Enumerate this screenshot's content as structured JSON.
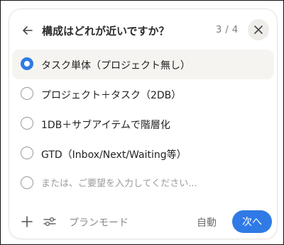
{
  "header": {
    "title": "構成はどれが近いですか？",
    "counter": "3 / 4"
  },
  "options": [
    {
      "label": "タスク単体（プロジェクト無し）",
      "selected": true
    },
    {
      "label": "プロジェクト＋タスク（2DB）",
      "selected": false
    },
    {
      "label": "1DB＋サブアイテムで階層化",
      "selected": false
    },
    {
      "label": "GTD（Inbox/Next/Waiting等）",
      "selected": false
    }
  ],
  "custom": {
    "placeholder": "または、ご要望を入力してください..."
  },
  "footer": {
    "plan_mode_label": "プランモード",
    "auto_label": "自動",
    "next_label": "次へ"
  },
  "colors": {
    "accent": "#2f7ae5",
    "selected_row_bg": "#f5f4f0",
    "close_button_bg": "#eeede9"
  },
  "icons": {
    "back": "arrow-left-icon",
    "close": "close-icon",
    "add": "plus-icon",
    "settings": "sliders-icon"
  }
}
